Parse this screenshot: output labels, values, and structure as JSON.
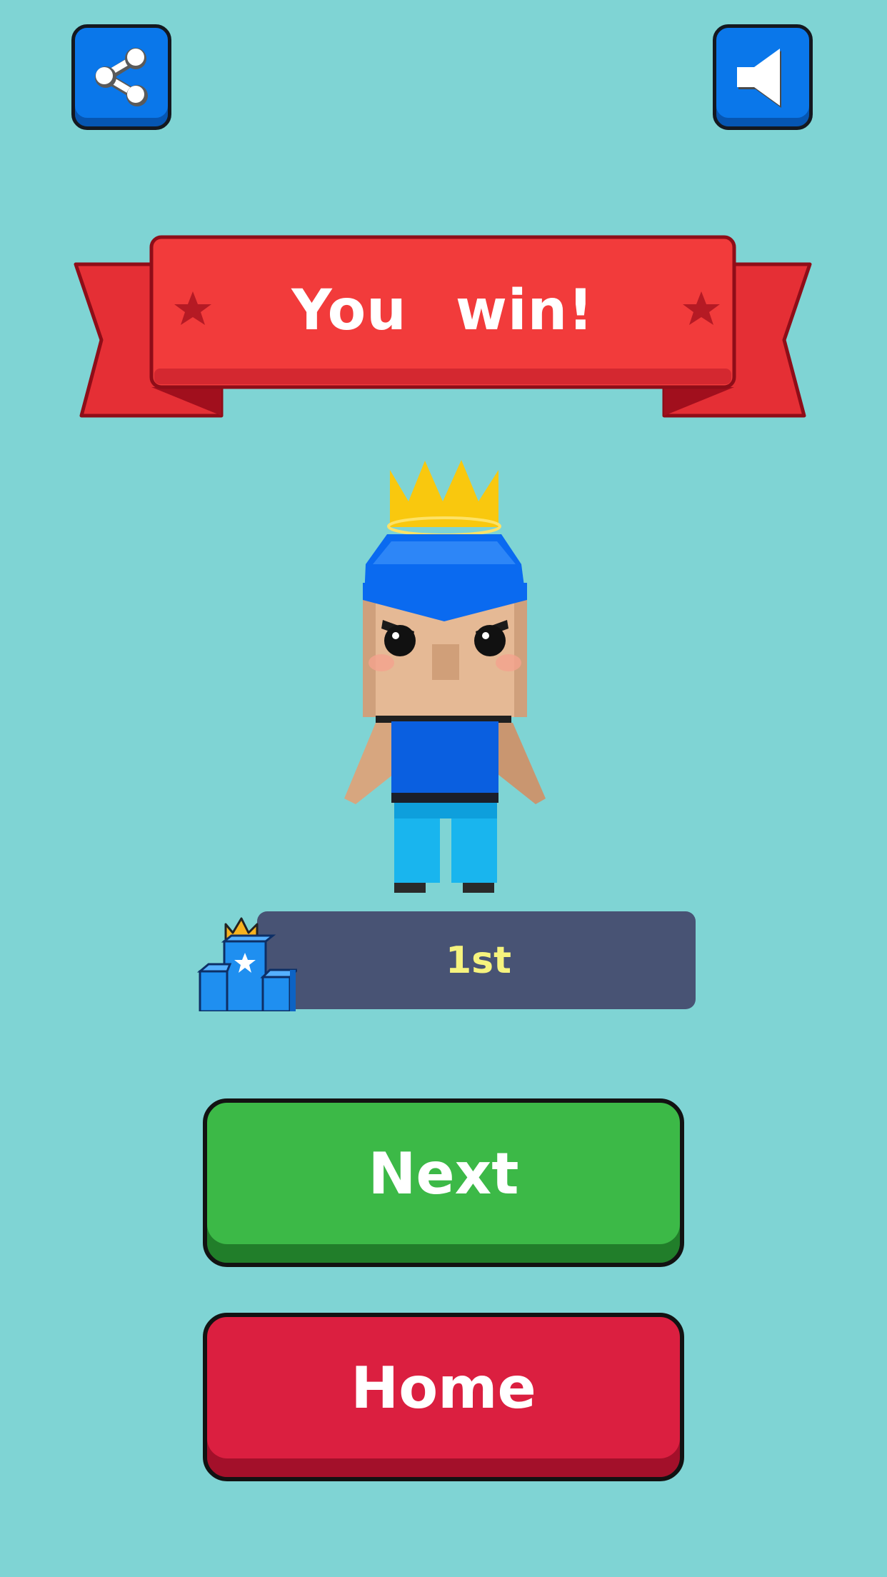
{
  "top_bar": {
    "share_icon": "share-icon",
    "sound_icon": "speaker-icon"
  },
  "banner": {
    "title": "You win!",
    "star_icon": "star-icon",
    "color": "#f23b3b"
  },
  "character": {
    "name_icon": "crowned-player-character",
    "crown_color": "#f9c80e",
    "outfit_color": "#0a6af0"
  },
  "rank": {
    "label": "1st",
    "icon": "podium-crown-icon",
    "bar_color": "#485374",
    "text_color": "#f6f37e"
  },
  "buttons": {
    "next_label": "Next",
    "home_label": "Home",
    "next_color": "#3cb947",
    "home_color": "#db1f40"
  }
}
